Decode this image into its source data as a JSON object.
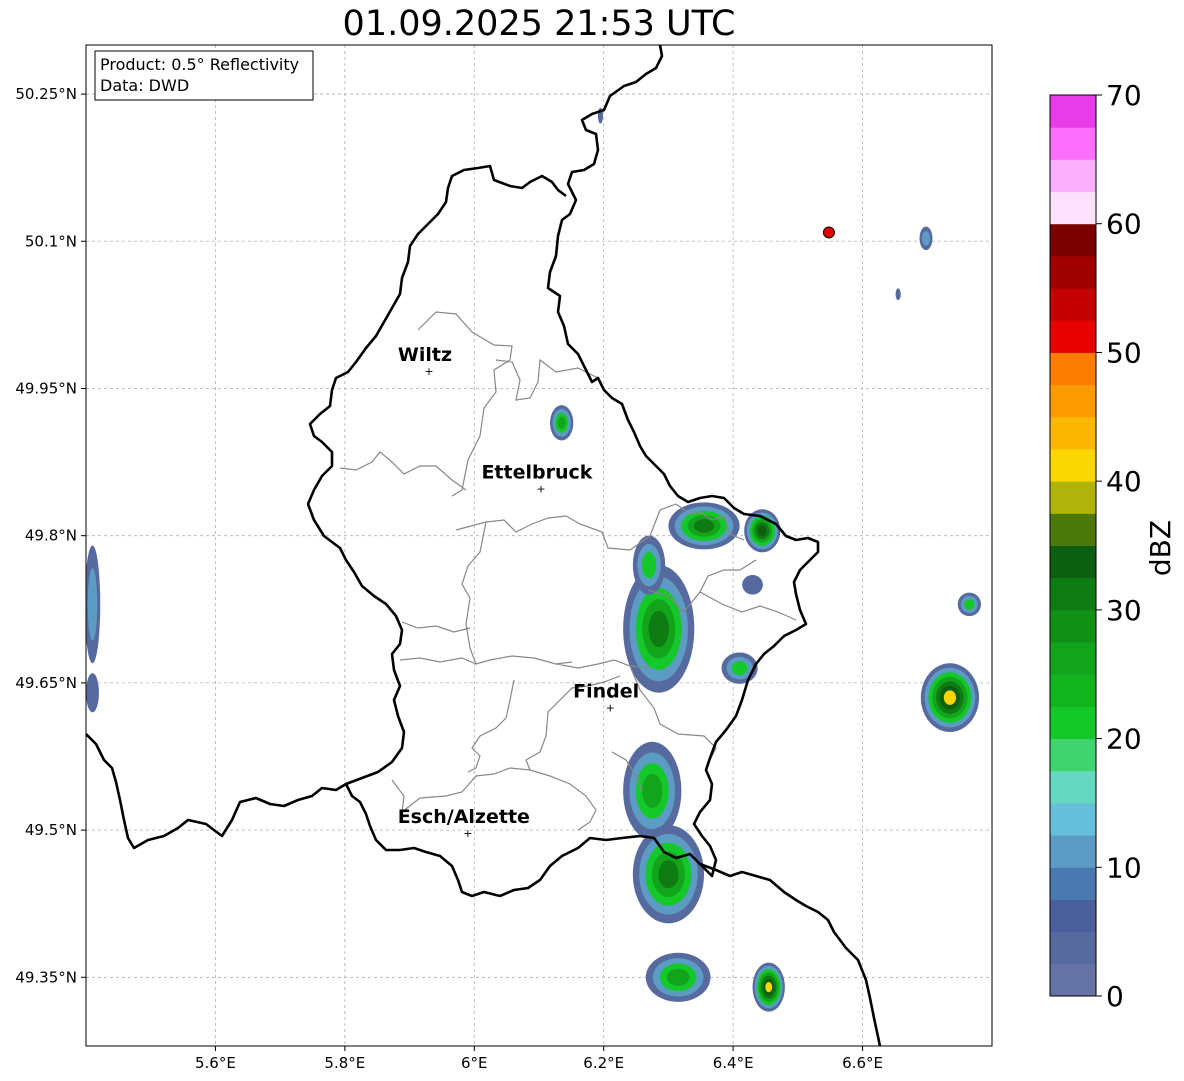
{
  "title": "01.09.2025 21:53 UTC",
  "info_box": {
    "line1": "Product: 0.5° Reflectivity",
    "line2": "Data: DWD"
  },
  "map": {
    "lon_range": [
      5.4,
      6.8
    ],
    "lat_range": [
      49.28,
      50.3
    ],
    "lon_ticks": [
      {
        "value": 5.6,
        "label": "5.6°E"
      },
      {
        "value": 5.8,
        "label": "5.8°E"
      },
      {
        "value": 6.0,
        "label": "6°E"
      },
      {
        "value": 6.2,
        "label": "6.2°E"
      },
      {
        "value": 6.4,
        "label": "6.4°E"
      },
      {
        "value": 6.6,
        "label": "6.6°E"
      }
    ],
    "lat_ticks": [
      {
        "value": 50.25,
        "label": "50.25°N"
      },
      {
        "value": 50.1,
        "label": "50.1°N"
      },
      {
        "value": 49.95,
        "label": "49.95°N"
      },
      {
        "value": 49.8,
        "label": "49.8°N"
      },
      {
        "value": 49.65,
        "label": "49.65°N"
      },
      {
        "value": 49.5,
        "label": "49.5°N"
      },
      {
        "value": 49.35,
        "label": "49.35°N"
      }
    ],
    "cities": [
      {
        "name": "Wiltz",
        "lon": 5.93,
        "lat": 49.968
      },
      {
        "name": "Ettelbruck",
        "lon": 6.103,
        "lat": 49.848
      },
      {
        "name": "Findel",
        "lon": 6.21,
        "lat": 49.625
      },
      {
        "name": "Esch/Alzette",
        "lon": 5.99,
        "lat": 49.497
      }
    ],
    "radar_site": {
      "lon": 6.548,
      "lat": 50.109,
      "color": "#e00000"
    },
    "echoes": [
      {
        "lon": 6.135,
        "lat": 49.915,
        "rx": 0.018,
        "ry": 0.018,
        "max_dbz": 27
      },
      {
        "lon": 6.355,
        "lat": 49.81,
        "rx": 0.055,
        "ry": 0.024,
        "max_dbz": 30
      },
      {
        "lon": 6.445,
        "lat": 49.805,
        "rx": 0.028,
        "ry": 0.022,
        "max_dbz": 38
      },
      {
        "lon": 6.285,
        "lat": 49.705,
        "rx": 0.055,
        "ry": 0.065,
        "max_dbz": 33
      },
      {
        "lon": 6.27,
        "lat": 49.77,
        "rx": 0.025,
        "ry": 0.03,
        "max_dbz": 22
      },
      {
        "lon": 6.41,
        "lat": 49.665,
        "rx": 0.028,
        "ry": 0.016,
        "max_dbz": 25
      },
      {
        "lon": 6.43,
        "lat": 49.75,
        "rx": 0.016,
        "ry": 0.01,
        "max_dbz": 8
      },
      {
        "lon": 6.275,
        "lat": 49.54,
        "rx": 0.045,
        "ry": 0.05,
        "max_dbz": 28
      },
      {
        "lon": 6.3,
        "lat": 49.455,
        "rx": 0.055,
        "ry": 0.05,
        "max_dbz": 30
      },
      {
        "lon": 6.315,
        "lat": 49.35,
        "rx": 0.05,
        "ry": 0.025,
        "max_dbz": 27
      },
      {
        "lon": 6.455,
        "lat": 49.34,
        "rx": 0.025,
        "ry": 0.025,
        "max_dbz": 42
      },
      {
        "lon": 6.735,
        "lat": 49.635,
        "rx": 0.045,
        "ry": 0.035,
        "max_dbz": 42
      },
      {
        "lon": 6.765,
        "lat": 49.73,
        "rx": 0.018,
        "ry": 0.012,
        "max_dbz": 25
      },
      {
        "lon": 6.698,
        "lat": 50.103,
        "rx": 0.01,
        "ry": 0.012,
        "max_dbz": 18
      },
      {
        "lon": 6.655,
        "lat": 50.046,
        "rx": 0.004,
        "ry": 0.006,
        "max_dbz": 6
      },
      {
        "lon": 6.195,
        "lat": 50.228,
        "rx": 0.004,
        "ry": 0.008,
        "max_dbz": 6
      },
      {
        "lon": 5.41,
        "lat": 49.73,
        "rx": 0.012,
        "ry": 0.06,
        "max_dbz": 12
      },
      {
        "lon": 5.41,
        "lat": 49.64,
        "rx": 0.01,
        "ry": 0.02,
        "max_dbz": 8
      }
    ]
  },
  "colorbar": {
    "label": "dBZ",
    "min": 0,
    "max": 70,
    "ticks": [
      0,
      10,
      20,
      30,
      40,
      50,
      60,
      70
    ],
    "colors": [
      "#6472a6",
      "#566a9f",
      "#4a5f9c",
      "#4a78b0",
      "#5c9cc4",
      "#66c0dc",
      "#66d8c2",
      "#40d470",
      "#14c82a",
      "#12b41e",
      "#12a41a",
      "#109014",
      "#0e7c12",
      "#0c5e10",
      "#4c780c",
      "#b0b40a",
      "#fcd600",
      "#fcb800",
      "#fc9c00",
      "#fc7e00",
      "#e80000",
      "#c40000",
      "#a00000",
      "#7c0000",
      "#fce0fc",
      "#fcb0fc",
      "#fc6efc",
      "#e83ce8"
    ]
  }
}
